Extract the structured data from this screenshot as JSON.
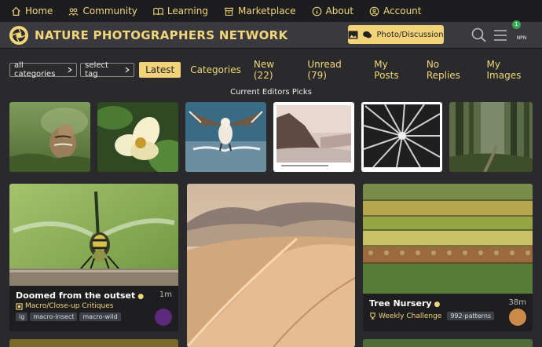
{
  "topnav": {
    "items": [
      {
        "label": "Home",
        "icon": "home-icon"
      },
      {
        "label": "Community",
        "icon": "community-icon"
      },
      {
        "label": "Learning",
        "icon": "learning-icon"
      },
      {
        "label": "Marketplace",
        "icon": "marketplace-icon"
      },
      {
        "label": "About",
        "icon": "info-icon"
      },
      {
        "label": "Account",
        "icon": "account-icon"
      }
    ]
  },
  "header": {
    "brand": "NATURE PHOTOGRAPHERS NETWORK",
    "photo_button": "Photo/Discussion",
    "user_badge": "NPN",
    "notification_count": "1"
  },
  "filters": {
    "categories_dropdown": "all categories",
    "tag_dropdown": "select tag",
    "tabs": [
      "Latest",
      "Categories",
      "New (22)",
      "Unread (79)",
      "My Posts",
      "No Replies",
      "My Images"
    ],
    "active_tab": "Latest"
  },
  "picks": {
    "title": "Current Editors Picks"
  },
  "cards": [
    {
      "title": "Doomed from the outset",
      "time": "1m",
      "category": "Macro/Close-up Critiques",
      "tags": [
        "ig",
        "macro-insect",
        "macro-wild"
      ]
    },
    {
      "title": "Tree Nursery",
      "time": "38m",
      "category": "Weekly Challenge",
      "tags": [
        "992-patterns"
      ]
    }
  ],
  "colors": {
    "accent": "#f1d77a",
    "background": "#2a2a2d"
  }
}
